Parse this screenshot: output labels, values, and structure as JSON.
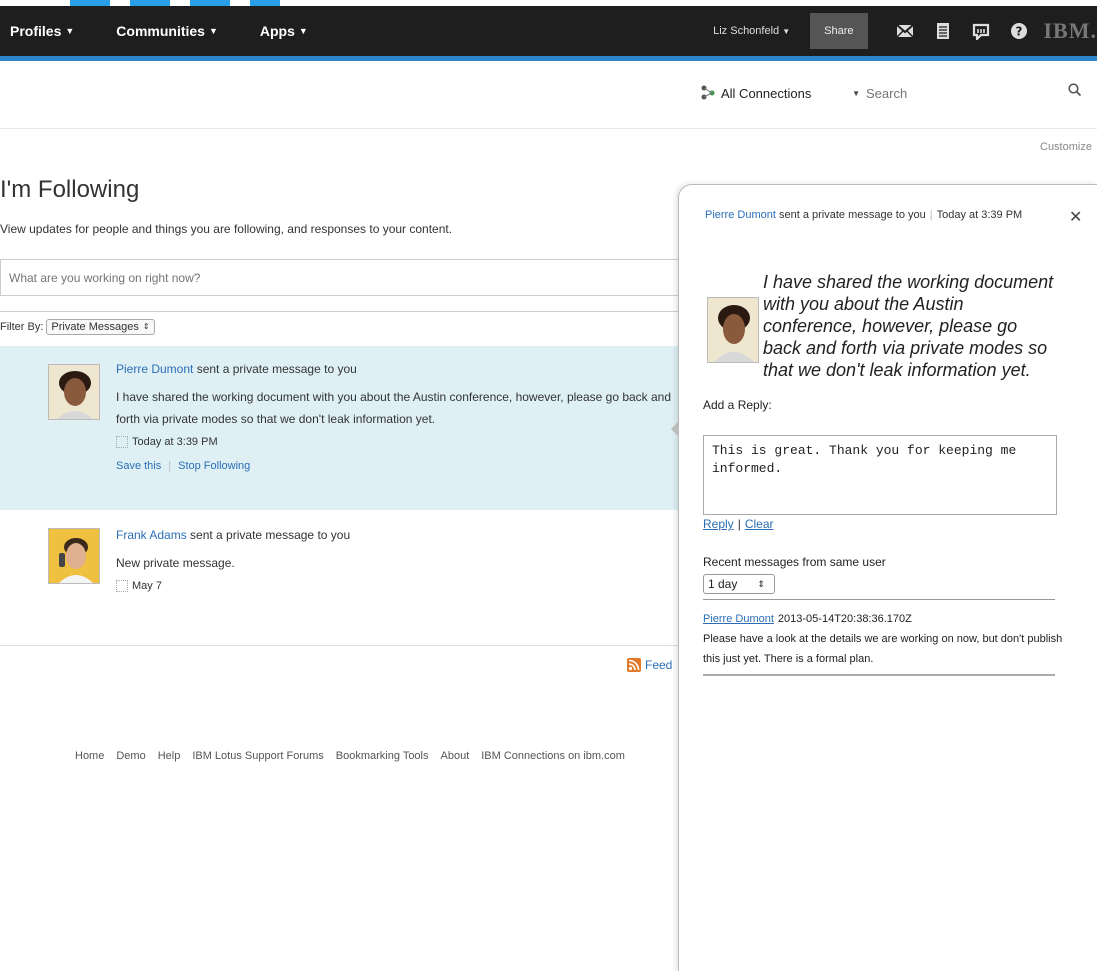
{
  "navbar": {
    "items": [
      {
        "label": "Profiles"
      },
      {
        "label": "Communities"
      },
      {
        "label": "Apps"
      }
    ],
    "user_name": "Liz Schonfeld",
    "share_label": "Share",
    "logo_text": "IBM."
  },
  "search": {
    "scope": "All Connections",
    "placeholder": "Search"
  },
  "customize_label": "Customize",
  "page": {
    "title": "I'm Following",
    "description": "View updates for people and things you are following, and responses to your content.",
    "status_placeholder": "What are you working on right now?",
    "filter_label": "Filter By:",
    "filter_value": "Private Messages"
  },
  "stories": [
    {
      "author": "Pierre Dumont",
      "action": " sent a private message to you",
      "text": "I have shared the working document with you about the Austin conference, however, please go back and forth via private modes so that we don't leak information yet.",
      "time": "Today at 3:39 PM",
      "save_label": "Save this",
      "stop_label": "Stop Following"
    },
    {
      "author": "Frank Adams",
      "action": " sent a private message to you",
      "text": "New private message.",
      "time": "May 7"
    }
  ],
  "feed_label": "Feed",
  "footer": [
    "Home",
    "Demo",
    "Help",
    "IBM Lotus Support Forums",
    "Bookmarking Tools",
    "About",
    "IBM Connections on ibm.com"
  ],
  "panel": {
    "author": "Pierre Dumont",
    "action": " sent a private message to you",
    "time": "Today at 3:39 PM",
    "quote": "I have shared the working document with you about the Austin conference, however, please go back and forth via private modes so that we don't leak information yet.",
    "reply_label": "Add a Reply:",
    "reply_value": "This is great. Thank you for keeping me informed.",
    "reply_button": "Reply",
    "clear_button": "Clear",
    "recent_label": "Recent messages from same user",
    "range_value": "1 day",
    "recent": {
      "author": "Pierre Dumont",
      "timestamp": "2013-05-14T20:38:36.170Z",
      "text": "Please have a look at the details we are working on now, but don't publish this just yet. There is a formal plan."
    }
  },
  "colors": {
    "navbar": "#1e1e1e",
    "accent_rule": "#2a86c8",
    "link": "#2a6fb6",
    "selected_story": "#dff0f4"
  }
}
